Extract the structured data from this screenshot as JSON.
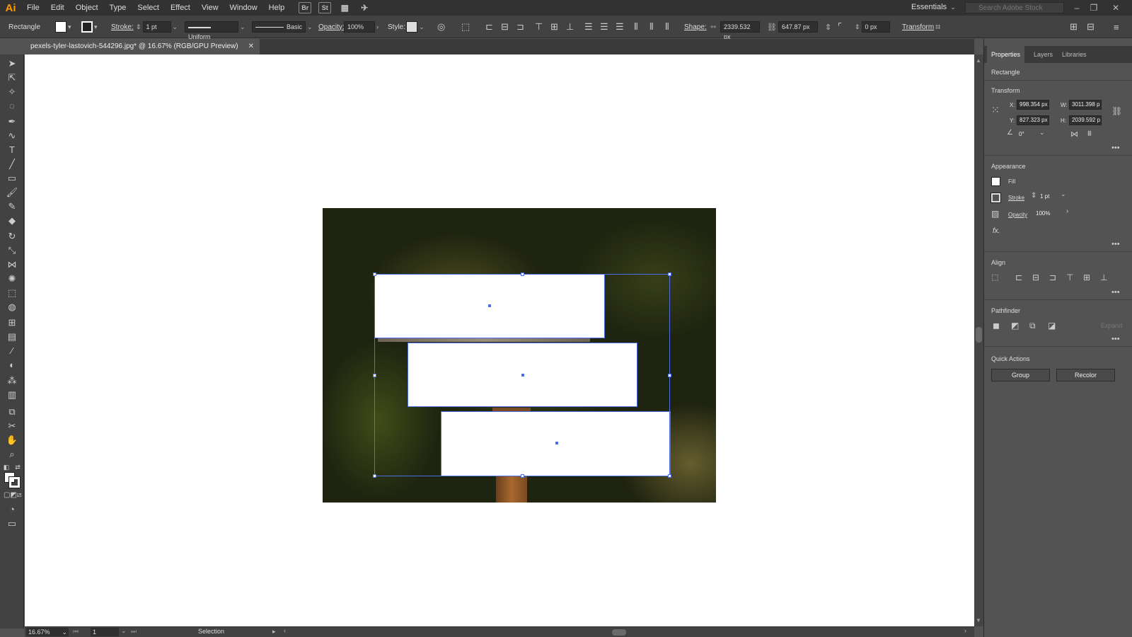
{
  "app": {
    "logo": "Ai"
  },
  "menu": {
    "items": [
      "File",
      "Edit",
      "Object",
      "Type",
      "Select",
      "Effect",
      "View",
      "Window",
      "Help"
    ],
    "bridge_label": "Br",
    "stock_label": "St"
  },
  "workspace": {
    "label": "Essentials"
  },
  "search": {
    "placeholder": "Search Adobe Stock"
  },
  "controlbar": {
    "object_type": "Rectangle",
    "stroke_label": "Stroke:",
    "stroke_weight": "1 pt",
    "stroke_profile": "Uniform",
    "brush": "Basic",
    "opacity_label": "Opacity:",
    "opacity_value": "100%",
    "style_label": "Style:",
    "shape_label": "Shape:",
    "shape_width": "2339.532 px",
    "shape_height": "647.87 px",
    "corner_radius": "0 px",
    "transform_label": "Transform"
  },
  "document": {
    "tab_title": "pexels-tyler-lastovich-544296.jpg* @ 16.67% (RGB/GPU Preview)"
  },
  "statusbar": {
    "zoom": "16.67%",
    "page": "1",
    "tool": "Selection"
  },
  "panel": {
    "tabs": [
      "Properties",
      "Layers",
      "Libraries"
    ],
    "object_type": "Rectangle",
    "transform": {
      "heading": "Transform",
      "x_label": "X:",
      "x": "998.354 px",
      "y_label": "Y:",
      "y": "827.323 px",
      "w_label": "W:",
      "w": "3011.398 p",
      "h_label": "H:",
      "h": "2039.592 p",
      "angle": "0°"
    },
    "appearance": {
      "heading": "Appearance",
      "fill_label": "Fill",
      "stroke_label": "Stroke",
      "stroke_weight": "1 pt",
      "opacity_label": "Opacity",
      "opacity_value": "100%",
      "fx_label": "fx."
    },
    "align": {
      "heading": "Align"
    },
    "pathfinder": {
      "heading": "Pathfinder",
      "expand_label": "Expand"
    },
    "quick_actions": {
      "heading": "Quick Actions",
      "group_label": "Group",
      "recolor_label": "Recolor"
    }
  },
  "colors": {
    "selection": "#4a6fe8",
    "app_logo": "#ff9a00",
    "ui_dark": "#323232",
    "ui_mid": "#424242",
    "ui_panel": "#535353"
  }
}
